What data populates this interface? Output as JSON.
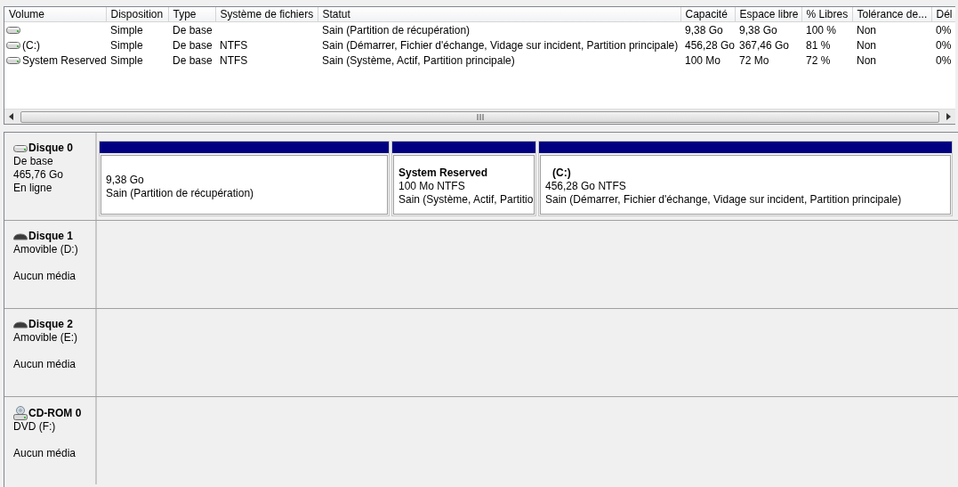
{
  "volume_list": {
    "columns": [
      "Volume",
      "Disposition",
      "Type",
      "Système de fichiers",
      "Statut",
      "Capacité",
      "Espace libre",
      "% Libres",
      "Tolérance de...",
      "Dél"
    ],
    "rows": [
      {
        "layout": "Simple",
        "type": "De base",
        "status": "Sain (Partition de récupération)",
        "capacity": "9,38 Go",
        "free_space": "9,38 Go",
        "percent_free": "100 %",
        "fault_tolerance": "Non",
        "column_10": "0%"
      },
      {
        "volume": "(C:)",
        "layout": "Simple",
        "type": "De base",
        "file_system": "NTFS",
        "status": "Sain (Démarrer, Fichier d'échange, Vidage sur incident, Partition principale)",
        "capacity": "456,28 Go",
        "free_space": "367,46 Go",
        "percent_free": "81 %",
        "fault_tolerance": "Non",
        "column_10": "0%"
      },
      {
        "volume": "System Reserved",
        "layout": "Simple",
        "type": "De base",
        "file_system": "NTFS",
        "status": "Sain (Système, Actif, Partition principale)",
        "capacity": "100 Mo",
        "free_space": "72 Mo",
        "percent_free": "72 %",
        "fault_tolerance": "Non",
        "column_10": "0%"
      }
    ]
  },
  "disks": [
    {
      "kind": "hdd",
      "name": "Disque 0",
      "lines": [
        "De base",
        "465,76 Go",
        "En ligne"
      ],
      "partitions": [
        {
          "size": "9,38 Go",
          "status": "Sain (Partition de récupération)"
        },
        {
          "name": "System Reserved",
          "size": "100 Mo NTFS",
          "status": "Sain (Système, Actif, Partitio"
        },
        {
          "name": "(C:)",
          "size": "456,28 Go NTFS",
          "status": "Sain (Démarrer, Fichier d'échange, Vidage sur incident, Partition principale)"
        }
      ]
    },
    {
      "kind": "removable",
      "name": "Disque 1",
      "type": "Amovible (D:)",
      "media": "Aucun média"
    },
    {
      "kind": "removable",
      "name": "Disque 2",
      "type": "Amovible (E:)",
      "media": "Aucun média"
    },
    {
      "kind": "cdrom",
      "name": "CD-ROM 0",
      "type": "DVD (F:)",
      "media": "Aucun média"
    }
  ]
}
